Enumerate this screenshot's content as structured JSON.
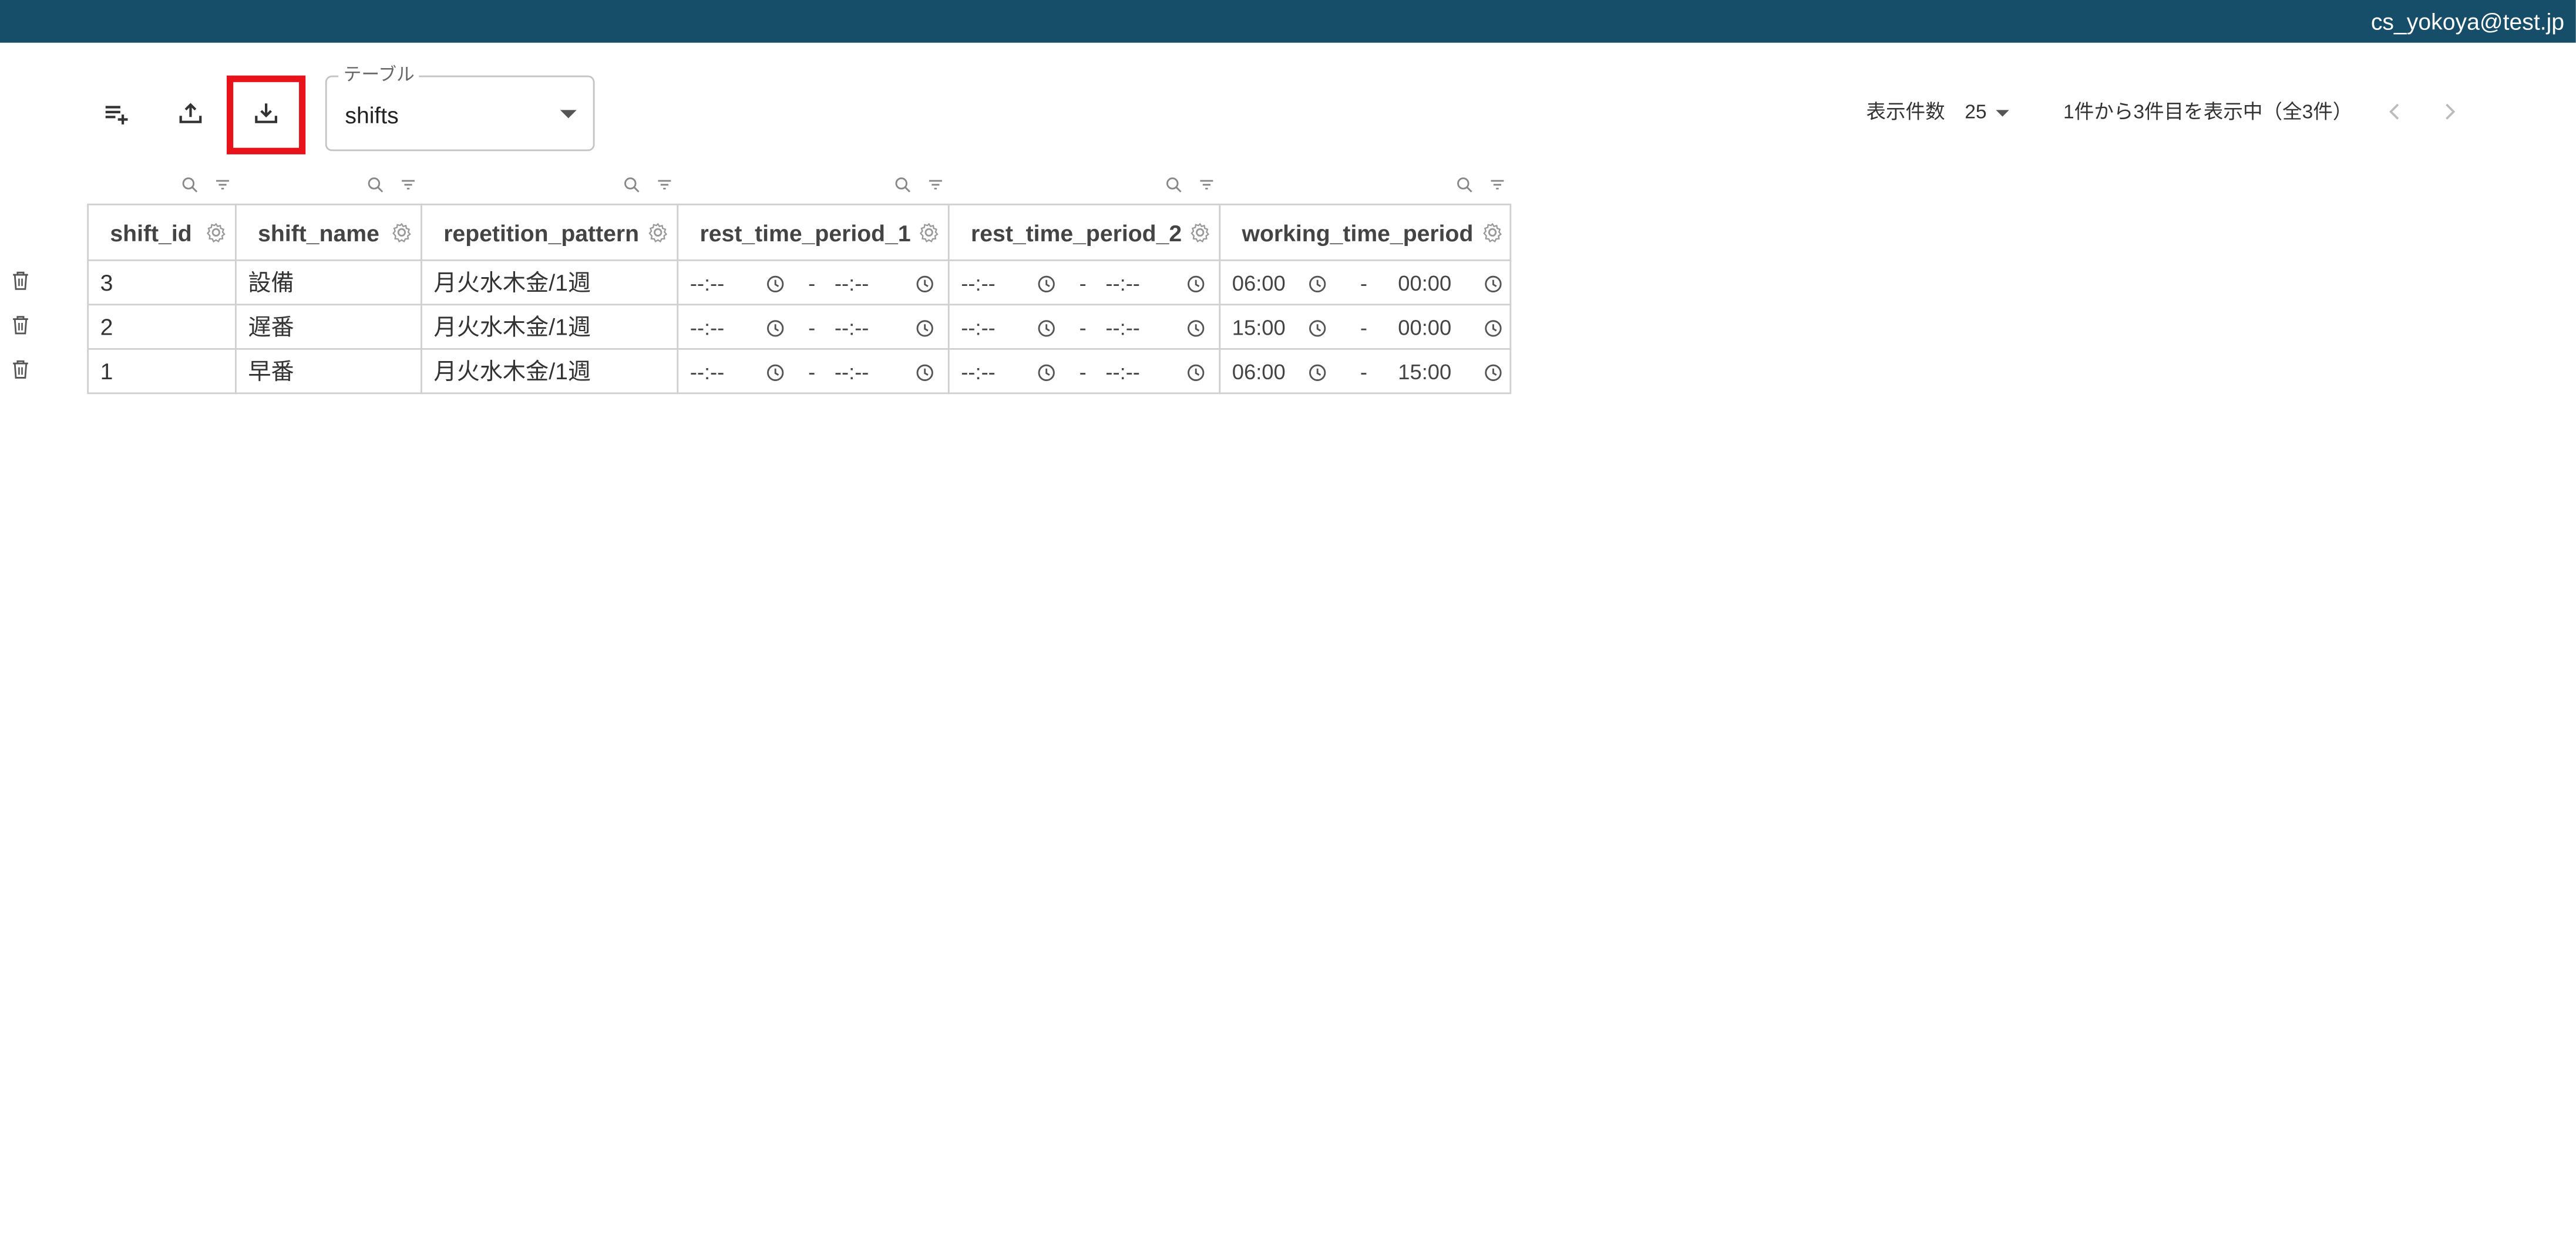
{
  "header": {
    "user_email": "cs_yokoya@test.jp"
  },
  "toolbar": {
    "add_row_icon": "playlist-add-icon",
    "upload_icon": "upload-icon",
    "download_icon": "download-icon",
    "highlight_color": "#e8121a"
  },
  "table_select": {
    "label": "テーブル",
    "value": "shifts"
  },
  "pagination": {
    "rows_per_page_label": "表示件数",
    "rows_per_page_value": "25",
    "range_text": "1件から3件目を表示中（全3件）",
    "prev_icon": "chevron-left-icon",
    "next_icon": "chevron-right-icon"
  },
  "table": {
    "columns": [
      "shift_id",
      "shift_name",
      "repetition_pattern",
      "rest_time_period_1",
      "rest_time_period_2",
      "working_time_period"
    ],
    "rows": [
      {
        "shift_id": "3",
        "shift_name": "設備",
        "repetition_pattern": "月火水木金/1週",
        "rest1_start": "--:--",
        "rest1_end": "--:--",
        "rest2_start": "--:--",
        "rest2_end": "--:--",
        "work_start": "06:00",
        "work_end": "00:00"
      },
      {
        "shift_id": "2",
        "shift_name": "遅番",
        "repetition_pattern": "月火水木金/1週",
        "rest1_start": "--:--",
        "rest1_end": "--:--",
        "rest2_start": "--:--",
        "rest2_end": "--:--",
        "work_start": "15:00",
        "work_end": "00:00"
      },
      {
        "shift_id": "1",
        "shift_name": "早番",
        "repetition_pattern": "月火水木金/1週",
        "rest1_start": "--:--",
        "rest1_end": "--:--",
        "rest2_start": "--:--",
        "rest2_end": "--:--",
        "work_start": "06:00",
        "work_end": "15:00"
      }
    ],
    "range_separator": "-"
  },
  "colors": {
    "topbar": "#164d69",
    "border": "#cfcfcf",
    "accent_highlight": "#e8121a"
  }
}
